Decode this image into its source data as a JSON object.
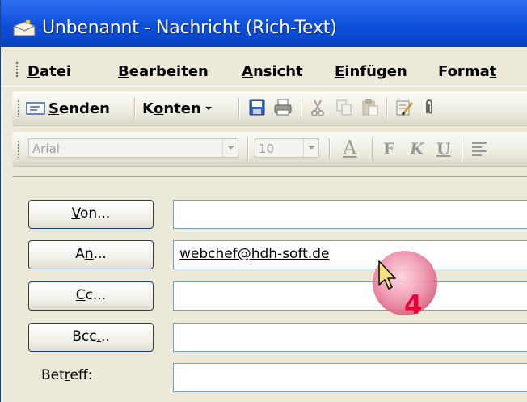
{
  "window": {
    "title": "Unbenannt - Nachricht (Rich-Text)"
  },
  "menu": [
    {
      "label_pre": "",
      "label_u": "D",
      "label_post": "atei"
    },
    {
      "label_pre": "",
      "label_u": "B",
      "label_post": "earbeiten"
    },
    {
      "label_pre": "",
      "label_u": "A",
      "label_post": "nsicht"
    },
    {
      "label_pre": "",
      "label_u": "E",
      "label_post": "infügen"
    },
    {
      "label_pre": "Forma",
      "label_u": "t",
      "label_post": ""
    }
  ],
  "toolbar": {
    "send": {
      "u": "S",
      "rest": "enden"
    },
    "accounts": {
      "pre": "K",
      "u": "o",
      "rest": "nten"
    },
    "icons": [
      "envelope-icon",
      "save-icon",
      "print-icon",
      "cut-icon",
      "copy-icon",
      "paste-icon",
      "check-names-icon",
      "attach-icon"
    ]
  },
  "format_toolbar": {
    "font": "Arial",
    "size": "10",
    "font_color_glyph": "A",
    "bold_glyph": "F",
    "italic_glyph": "K",
    "underline_glyph": "U"
  },
  "fields": {
    "from": {
      "label_pre": "",
      "label_u": "V",
      "label_post": "on..."
    },
    "to": {
      "label_pre": "A",
      "label_u": "n",
      "label_post": "...",
      "value": "webchef@hdh-soft.de"
    },
    "cc": {
      "label_pre": "",
      "label_u": "C",
      "label_post": "c..."
    },
    "bcc": {
      "label_pre": "Bcc",
      "label_u": ".",
      "label_post": ".."
    },
    "subject": {
      "label_pre": "Bet",
      "label_u": "r",
      "label_post": "eff:"
    }
  },
  "annotation": {
    "step": "4"
  },
  "colors": {
    "titlebar": "#0a48cf",
    "window_bg": "#ece9d8",
    "marker": "#e0507a",
    "step_number": "#e8003c"
  }
}
